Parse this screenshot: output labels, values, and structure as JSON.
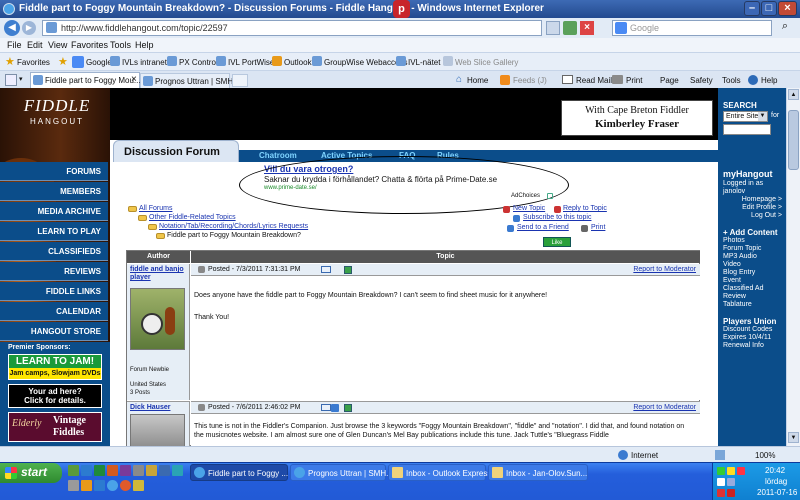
{
  "titlebar": {
    "text": "Fiddle part to Foggy Mountain Breakdown? - Discussion Forums - Fiddle Hangout - Windows Internet Explorer"
  },
  "addressbar": {
    "url": "http://www.fiddlehangout.com/topic/22597",
    "search_placeholder": "Google"
  },
  "menubar": [
    "File",
    "Edit",
    "View",
    "Favorites",
    "Tools",
    "Help"
  ],
  "favorites": {
    "label": "Favorites",
    "items": [
      "Google",
      "IVLs intranet",
      "PX Control",
      "IVL PortWise",
      "Outlook",
      "GroupWise Webaccess",
      "IVL-nätet",
      "Web Slice Gallery"
    ]
  },
  "tabs": [
    {
      "label": "Fiddle part to Foggy Mou...",
      "close": "×"
    },
    {
      "label": "Prognos Uttran | SMHI"
    }
  ],
  "commandbar": [
    "Home",
    "Feeds (J)",
    "Read Mail",
    "Print",
    "Page",
    "Safety",
    "Tools",
    "Help"
  ],
  "site": {
    "logo_top": "FIDDLE",
    "logo_bottom": "HANGOUT",
    "banner_line1": "With Cape Breton Fiddler",
    "banner_line2": "Kimberley Fraser",
    "search_label": "SEARCH",
    "search_select": "Entire Site",
    "search_for": "for",
    "section_title": "Discussion Forum",
    "nav": [
      "Chatroom",
      "Active Topics",
      "FAQ",
      "Rules"
    ],
    "sidebar": [
      "FORUMS",
      "MEMBERS",
      "MEDIA ARCHIVE",
      "LEARN TO PLAY",
      "CLASSIFIEDS",
      "REVIEWS",
      "FIDDLE LINKS",
      "CALENDAR",
      "HANGOUT STORE"
    ],
    "premier_label": "Premier Sponsors:",
    "sponsor1_line1": "LEARN TO JAM!",
    "sponsor1_line2": "Jam camps, Slowjam DVDs",
    "sponsor2_line1": "Your ad here?",
    "sponsor2_line2": "Click for details.",
    "sponsor3_left": "Elderly",
    "sponsor3_right1": "Vintage",
    "sponsor3_right2": "Fiddles"
  },
  "ad": {
    "title": "Vill du vara otrogen?",
    "text": "Saknar du krydda i förhållandet? Chatta & flörta på Prime-Date.se",
    "url": "www.prime-date.se/",
    "choices": "AdChoices"
  },
  "breadcrumb": [
    "All Forums",
    "Other Fiddle-Related Topics",
    "Notation/Tab/Recording/Chords/Lyrics Requests",
    "Fiddle part to Foggy Mountain Breakdown?"
  ],
  "actions": {
    "new_topic": "New Topic",
    "reply": "Reply to Topic",
    "subscribe": "Subscribe to this topic",
    "send": "Send to a Friend",
    "print": "Print",
    "like": "Like"
  },
  "table": {
    "author_header": "Author",
    "topic_header": "Topic"
  },
  "posts": [
    {
      "author": "fiddle and banjo player",
      "role": "Forum Newbie",
      "country": "United States",
      "count": "3 Posts",
      "date": "Posted - 7/3/2011 7:31:31 PM",
      "report": "Report to Moderator",
      "body": "Does anyone have the fiddle part to Foggy Mountain Breakdown?  I can't seem to find sheet music for it anywhere!",
      "body2": "Thank You!"
    },
    {
      "author": "Dick Hauser",
      "date": "Posted - 7/6/2011 2:46:02 PM",
      "report": "Report to Moderator",
      "body": "This tune is not in the Fiddler's Companion.  Just browse the 3 keywords \"Foggy Mountain Breakdown\", \"fiddle\" and \"notation\".  I did that, and found notation on the musicnotes website.  I am almost sure one of Glen Duncan's Mel Bay publications include this tune. Jack Tuttle's \"Bluegrass Fiddle"
    }
  ],
  "right": {
    "title": "myHangout",
    "logged1": "Logged in as",
    "logged2": "janolov",
    "links": [
      "Homepage >",
      "Edit Profile >",
      "Log Out >"
    ],
    "add_title": "+ Add Content",
    "add_items": [
      "Photos",
      "Forum Topic",
      "MP3 Audio",
      "Video",
      "Blog Entry",
      "Event",
      "Classified Ad",
      "Review",
      "Tablature"
    ],
    "union_title": "Players Union",
    "union_items": [
      "Discount Codes",
      "Expires 10/4/11",
      "Renewal Info"
    ]
  },
  "status": {
    "zone": "Internet",
    "zoom": "100%"
  },
  "taskbar": {
    "start": "start",
    "items": [
      "Fiddle part to Foggy ...",
      "Prognos Uttran | SMH...",
      "Inbox - Outlook Express",
      "Inbox - Jan-Olov.Sun..."
    ],
    "time": "20:42",
    "day": "lördag",
    "date": "2011-07-16"
  }
}
